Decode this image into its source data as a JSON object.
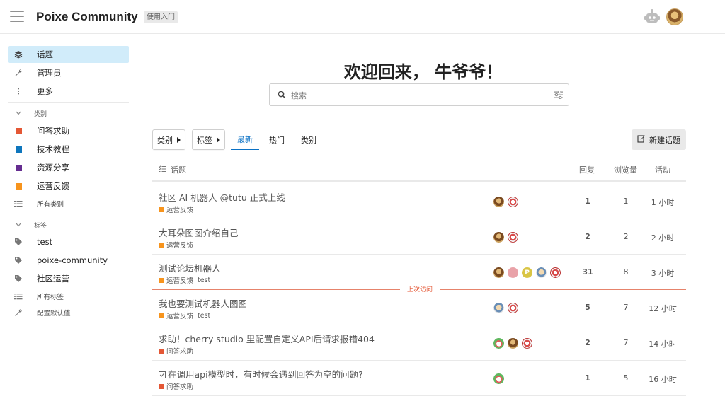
{
  "header": {
    "site_title": "Poixe Community",
    "badge": "使用入门"
  },
  "sidebar": {
    "top_items": [
      {
        "label": "话题",
        "icon": "layers-icon",
        "active": true
      },
      {
        "label": "管理员",
        "icon": "wrench-icon"
      },
      {
        "label": "更多",
        "icon": "more-vertical-icon"
      }
    ],
    "categories_header": "类别",
    "categories": [
      {
        "label": "问答求助",
        "color": "#e45735"
      },
      {
        "label": "技术教程",
        "color": "#0e76bd"
      },
      {
        "label": "资源分享",
        "color": "#652d90"
      },
      {
        "label": "运营反馈",
        "color": "#f7941d"
      }
    ],
    "all_categories": "所有类别",
    "tags_header": "标签",
    "tags": [
      "test",
      "poixe-community",
      "社区运营"
    ],
    "all_tags": "所有标签",
    "configure_defaults": "配置默认值"
  },
  "main": {
    "welcome": "欢迎回来， 牛爷爷！",
    "search_placeholder": "搜索",
    "nav": {
      "categories_btn": "类别",
      "tags_btn": "标签",
      "tabs": [
        "最新",
        "热门",
        "类别"
      ],
      "active_tab": "最新",
      "new_topic": "新建话题"
    },
    "columns": {
      "topic": "话题",
      "replies": "回复",
      "views": "浏览量",
      "activity": "活动"
    },
    "last_visit": "上次访问",
    "topics": [
      {
        "title": "社区 AI 机器人 @tutu 正式上线",
        "category": "运营反馈",
        "category_color": "#f7941d",
        "tags": [],
        "posters": [
          "brown",
          "red"
        ],
        "replies": "1",
        "views": "1",
        "activity": "1 小时"
      },
      {
        "title": "大耳朵图图介绍自己",
        "category": "运营反馈",
        "category_color": "#f7941d",
        "tags": [],
        "posters": [
          "brown",
          "red"
        ],
        "replies": "2",
        "views": "2",
        "activity": "2 小时"
      },
      {
        "title": "测试论坛机器人",
        "category": "运营反馈",
        "category_color": "#f7941d",
        "tags": [
          "test"
        ],
        "posters": [
          "brown",
          "pink",
          "p",
          "robot",
          "red"
        ],
        "replies": "31",
        "views": "8",
        "activity": "3 小时"
      },
      {
        "title": "我也要测试机器人图图",
        "category": "运营反馈",
        "category_color": "#f7941d",
        "tags": [
          "test"
        ],
        "posters": [
          "robot",
          "red"
        ],
        "replies": "5",
        "views": "7",
        "activity": "12 小时"
      },
      {
        "title": "求助！cherry studio 里配置自定义API后请求报错404",
        "category": "问答求助",
        "category_color": "#e45735",
        "tags": [],
        "posters": [
          "green",
          "brown",
          "red"
        ],
        "replies": "2",
        "views": "7",
        "activity": "14 小时"
      },
      {
        "title": "在调用api模型时，有时候会遇到回答为空的问题?",
        "category": "问答求助",
        "category_color": "#e45735",
        "tags": [],
        "posters": [
          "green"
        ],
        "replies": "1",
        "views": "5",
        "activity": "16 小时",
        "solved": true
      }
    ]
  }
}
